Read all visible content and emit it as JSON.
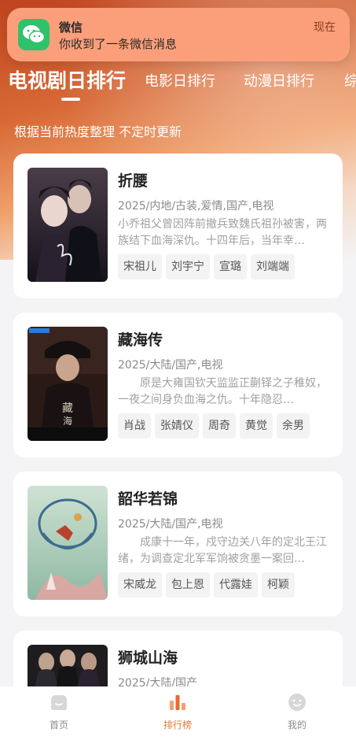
{
  "notification": {
    "app_name": "微信",
    "message": "你收到了一条微信消息",
    "time": "现在"
  },
  "tabs": [
    {
      "label": "电视剧日排行",
      "active": true
    },
    {
      "label": "电影日排行",
      "active": false
    },
    {
      "label": "动漫日排行",
      "active": false
    },
    {
      "label": "综",
      "active": false
    }
  ],
  "subtitle": "根据当前热度整理 不定时更新",
  "cards": [
    {
      "title": "折腰",
      "meta": "2025/内地/古装,爱情,国产,电视",
      "desc": "小乔祖父曾因阵前撤兵致魏氏祖孙被害，两族结下血海深仇。十四年后，当年幸…",
      "cast": [
        "宋祖儿",
        "刘宇宁",
        "宣璐",
        "刘端端"
      ]
    },
    {
      "title": "藏海传",
      "meta": "2025/大陆/国产,电视",
      "desc": "　　原是大雍国钦天监监正蒯铎之子稚奴，一夜之间身负血海之仇。十年隐忍…",
      "cast": [
        "肖战",
        "张婧仪",
        "周奇",
        "黄觉",
        "余男"
      ]
    },
    {
      "title": "韶华若锦",
      "meta": "2025/大陆/国产,电视",
      "desc": "　　成康十一年，戍守边关八年的定北王江绪，为调查定北军军饷被贪墨一案回…",
      "cast": [
        "宋威龙",
        "包上恩",
        "代露娃",
        "柯颖"
      ]
    },
    {
      "title": "狮城山海",
      "meta": "2025/大陆/国产",
      "desc": "",
      "cast": []
    }
  ],
  "bottom_nav": [
    {
      "label": "首页",
      "icon": "home-icon",
      "active": false
    },
    {
      "label": "排行榜",
      "icon": "ranking-icon",
      "active": true
    },
    {
      "label": "我的",
      "icon": "profile-icon",
      "active": false
    }
  ],
  "colors": {
    "accent": "#e87a35",
    "notification_bg": "#fb9f7b",
    "wechat_green": "#2ec26a"
  }
}
